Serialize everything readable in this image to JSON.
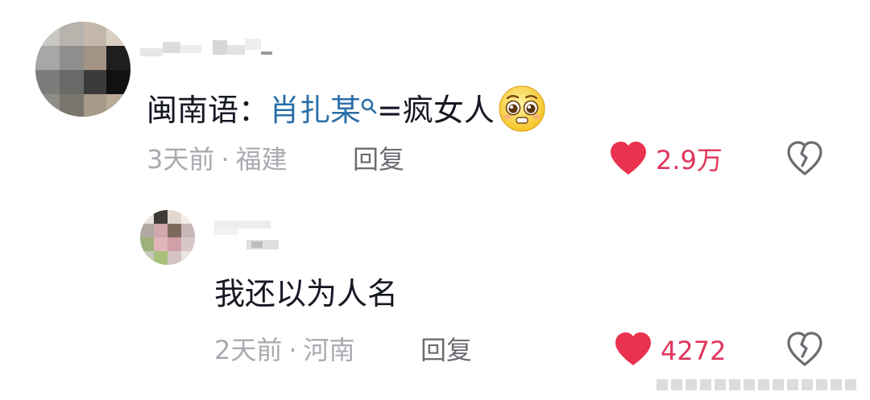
{
  "comments": [
    {
      "text_prefix": "闽南语：",
      "highlight": "肖扎某",
      "text_suffix": "=疯女人",
      "emoji": "pleading-face",
      "time": "3天前",
      "location": "福建",
      "reply_label": "回复",
      "likes": "2.9万"
    },
    {
      "text": "我还以为人名",
      "time": "2天前",
      "location": "河南",
      "reply_label": "回复",
      "likes": "4272"
    }
  ],
  "meta_separator": "·",
  "colors": {
    "like": "#e0365c",
    "highlight": "#2a6ea8",
    "meta": "#a9aab0"
  },
  "icons": {
    "like": "heart-icon",
    "dislike": "broken-heart-icon",
    "search": "search-icon"
  }
}
